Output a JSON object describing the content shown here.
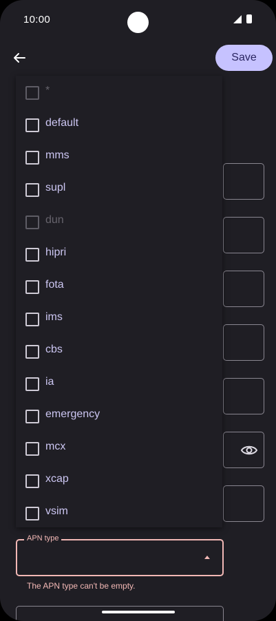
{
  "status_bar": {
    "time": "10:00"
  },
  "toolbar": {
    "save_label": "Save"
  },
  "apn_type_menu": {
    "options": [
      {
        "label": "*",
        "disabled": true
      },
      {
        "label": "default",
        "disabled": false
      },
      {
        "label": "mms",
        "disabled": false
      },
      {
        "label": "supl",
        "disabled": false
      },
      {
        "label": "dun",
        "disabled": true
      },
      {
        "label": "hipri",
        "disabled": false
      },
      {
        "label": "fota",
        "disabled": false
      },
      {
        "label": "ims",
        "disabled": false
      },
      {
        "label": "cbs",
        "disabled": false
      },
      {
        "label": "ia",
        "disabled": false
      },
      {
        "label": "emergency",
        "disabled": false
      },
      {
        "label": "mcx",
        "disabled": false
      },
      {
        "label": "xcap",
        "disabled": false
      },
      {
        "label": "vsim",
        "disabled": false
      }
    ]
  },
  "apn_type_field": {
    "label": "APN type",
    "value": "",
    "error": "The APN type can't be empty."
  },
  "colors": {
    "surface": "#1f1e24",
    "accent": "#c6c2ff",
    "error": "#f2b8b5"
  }
}
